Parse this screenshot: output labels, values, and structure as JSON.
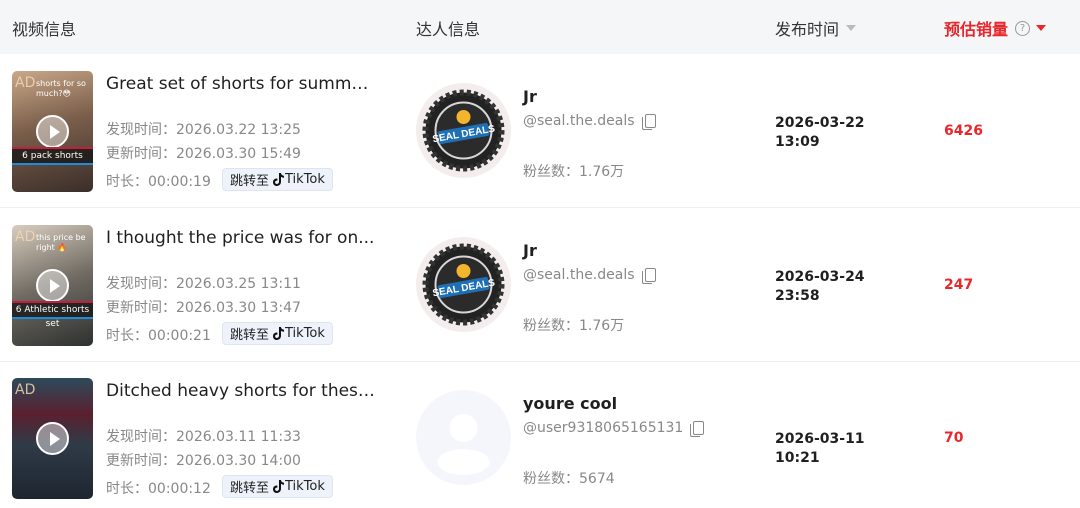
{
  "header": {
    "video_info": "视频信息",
    "creator_info": "达人信息",
    "publish_time": "发布时间",
    "estimated_sales": "预估销量"
  },
  "rows": [
    {
      "thumb": {
        "ad": "AD",
        "text_top": "shorts for so much?😳",
        "caption": "6 pack shorts"
      },
      "title": "Great set of shorts for summer...",
      "discovered": "发现时间：2026.03.22 13:25",
      "updated": "更新时间：2026.03.30 15:49",
      "duration": "时长：00:00:19",
      "jump_label": "跳转至",
      "platform": "TikTok",
      "creator_name": "Jr",
      "handle": "@seal.the.deals",
      "fans": "粉丝数：1.76万",
      "publish_date": "2026-03-22",
      "publish_clock": "13:09",
      "sales": "6426"
    },
    {
      "thumb": {
        "ad": "AD",
        "text_top": "this price be right 🔥",
        "caption": "6 Athletic shorts set"
      },
      "title": "I thought the price was for on...",
      "discovered": "发现时间：2026.03.25 13:11",
      "updated": "更新时间：2026.03.30 13:47",
      "duration": "时长：00:00:21",
      "jump_label": "跳转至",
      "platform": "TikTok",
      "creator_name": "Jr",
      "handle": "@seal.the.deals",
      "fans": "粉丝数：1.76万",
      "publish_date": "2026-03-24",
      "publish_clock": "23:58",
      "sales": "247"
    },
    {
      "thumb": {
        "ad": "AD",
        "text_top": "",
        "caption": ""
      },
      "title": "Ditched heavy shorts for these...",
      "discovered": "发现时间：2026.03.11 11:33",
      "updated": "更新时间：2026.03.30 14:00",
      "duration": "时长：00:00:12",
      "jump_label": "跳转至",
      "platform": "TikTok",
      "creator_name": "youre cool",
      "handle": "@user9318065165131",
      "fans": "粉丝数：5674",
      "publish_date": "2026-03-11 10:21",
      "publish_clock": "",
      "sales": "70"
    }
  ],
  "avatar_logo": {
    "line1": "SEAL",
    "line2": "DEALS"
  },
  "colors": {
    "accent_red": "#e8262c",
    "header_bg": "#f5f6f8",
    "tiktok_btn_bg": "#eef3fb"
  }
}
